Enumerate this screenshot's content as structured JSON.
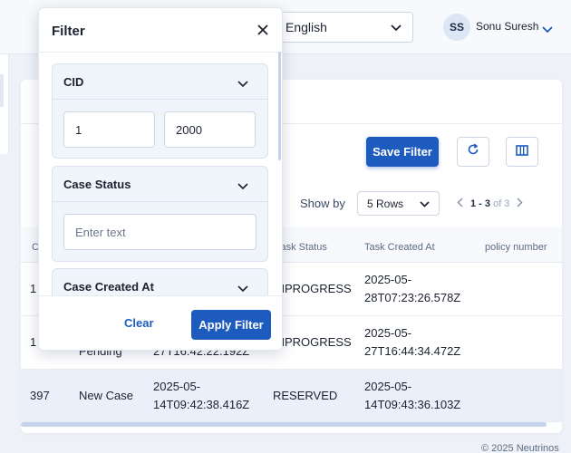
{
  "header": {
    "language": "English",
    "user_initials": "SS",
    "user_name": "Sonu Suresh"
  },
  "toolbar": {
    "save_filter_label": "Save Filter",
    "show_by_label": "Show by",
    "rows_value": "5 Rows",
    "pager_current": "1 - 3",
    "pager_of": "of 3"
  },
  "table": {
    "columns": [
      "CI",
      "Task Status",
      "Task Created At",
      "policy number"
    ],
    "rows": [
      {
        "cid": "1",
        "case_status": "",
        "created": "",
        "task_status": "INPROGRESS",
        "task_created": "2025-05-28T07:23:26.578Z"
      },
      {
        "cid": "1",
        "case_status": "Pending",
        "created": "27T16:42:22.192Z",
        "task_status": "INPROGRESS",
        "task_created": "2025-05-27T16:44:34.472Z"
      },
      {
        "cid": "397",
        "case_status": "New Case",
        "created": "2025-05-14T09:42:38.416Z",
        "task_status": "RESERVED",
        "task_created": "2025-05-14T09:43:36.103Z"
      }
    ]
  },
  "footer": {
    "copyright": "© 2025 Neutrinos"
  },
  "filter": {
    "title": "Filter",
    "sections": {
      "cid": {
        "label": "CID",
        "from_value": "1",
        "to_value": "2000"
      },
      "case_status": {
        "label": "Case Status",
        "placeholder": "Enter text"
      },
      "case_created_at": {
        "label": "Case Created At"
      }
    },
    "clear_label": "Clear",
    "apply_label": "Apply Filter"
  },
  "colors": {
    "primary": "#1e5bbf",
    "background": "#eef2f8",
    "selected_row": "#eaf0fa"
  }
}
